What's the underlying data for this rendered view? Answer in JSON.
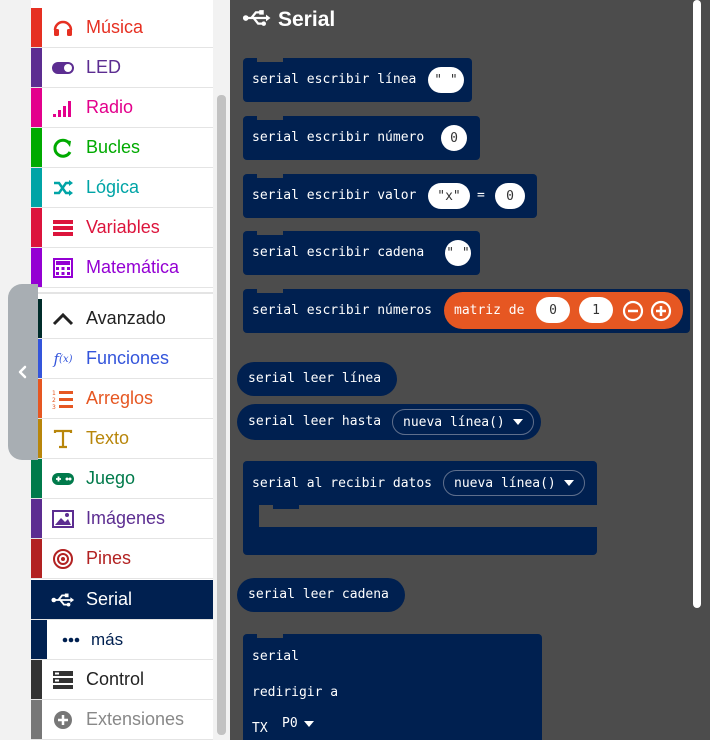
{
  "toolbox": {
    "categories": [
      {
        "label": "Música",
        "color": "#e63022",
        "icon": "headphones-icon"
      },
      {
        "label": "LED",
        "color": "#5c2d91",
        "icon": "toggle-icon"
      },
      {
        "label": "Radio",
        "color": "#e3008c",
        "icon": "signal-bars-icon"
      },
      {
        "label": "Bucles",
        "color": "#00aa00",
        "icon": "loop-arrow-icon"
      },
      {
        "label": "Lógica",
        "color": "#00a4a6",
        "icon": "shuffle-icon"
      },
      {
        "label": "Variables",
        "color": "#dc143c",
        "icon": "list-lines-icon"
      },
      {
        "label": "Matemática",
        "color": "#9400d3",
        "icon": "calculator-icon"
      },
      {
        "label": "Avanzado",
        "color": "#002c2a",
        "icon": "chevron-up-icon"
      },
      {
        "label": "Funciones",
        "color": "#3455db",
        "icon": "function-icon"
      },
      {
        "label": "Arreglos",
        "color": "#e65722",
        "icon": "numbered-list-icon"
      },
      {
        "label": "Texto",
        "color": "#b8860b",
        "icon": "text-t-icon"
      },
      {
        "label": "Juego",
        "color": "#007a4b",
        "icon": "gamepad-icon"
      },
      {
        "label": "Imágenes",
        "color": "#5c2d91",
        "icon": "image-icon"
      },
      {
        "label": "Pines",
        "color": "#b22222",
        "icon": "target-icon"
      },
      {
        "label": "Serial",
        "color": "#002050",
        "icon": "usb-icon"
      },
      {
        "label": "más",
        "color": "#002050",
        "icon": "more-dots-icon"
      },
      {
        "label": "Control",
        "color": "#333333",
        "icon": "control-stack-icon"
      },
      {
        "label": "Extensiones",
        "color": "#777777",
        "icon": "plus-circle-icon"
      }
    ],
    "selected": "Serial"
  },
  "flyout": {
    "title": "Serial",
    "icon": "usb-icon",
    "blocks": {
      "write_line": {
        "label": "serial escribir línea",
        "value": "\" \""
      },
      "write_number": {
        "label": "serial escribir número",
        "value": "0"
      },
      "write_value": {
        "label": "serial escribir valor",
        "name": "\"x\"",
        "eq": "=",
        "value": "0"
      },
      "write_string": {
        "label": "serial escribir cadena",
        "value": "\" \""
      },
      "write_numbers": {
        "label": "serial escribir números",
        "array_label": "matriz de",
        "v1": "0",
        "v2": "1"
      },
      "read_line": {
        "label": "serial leer línea"
      },
      "read_until": {
        "label": "serial leer hasta",
        "option": "nueva línea()"
      },
      "on_data": {
        "label": "serial al recibir datos",
        "option": "nueva línea()"
      },
      "read_string": {
        "label": "serial leer cadena"
      },
      "redirect": {
        "line1": "serial",
        "line2": "redirigir a",
        "tx_label": "TX",
        "tx_value": "P0"
      }
    }
  },
  "colors": {
    "accent": "#002050",
    "flyout_bg": "#4c4c4c",
    "array_block": "#e65722"
  }
}
